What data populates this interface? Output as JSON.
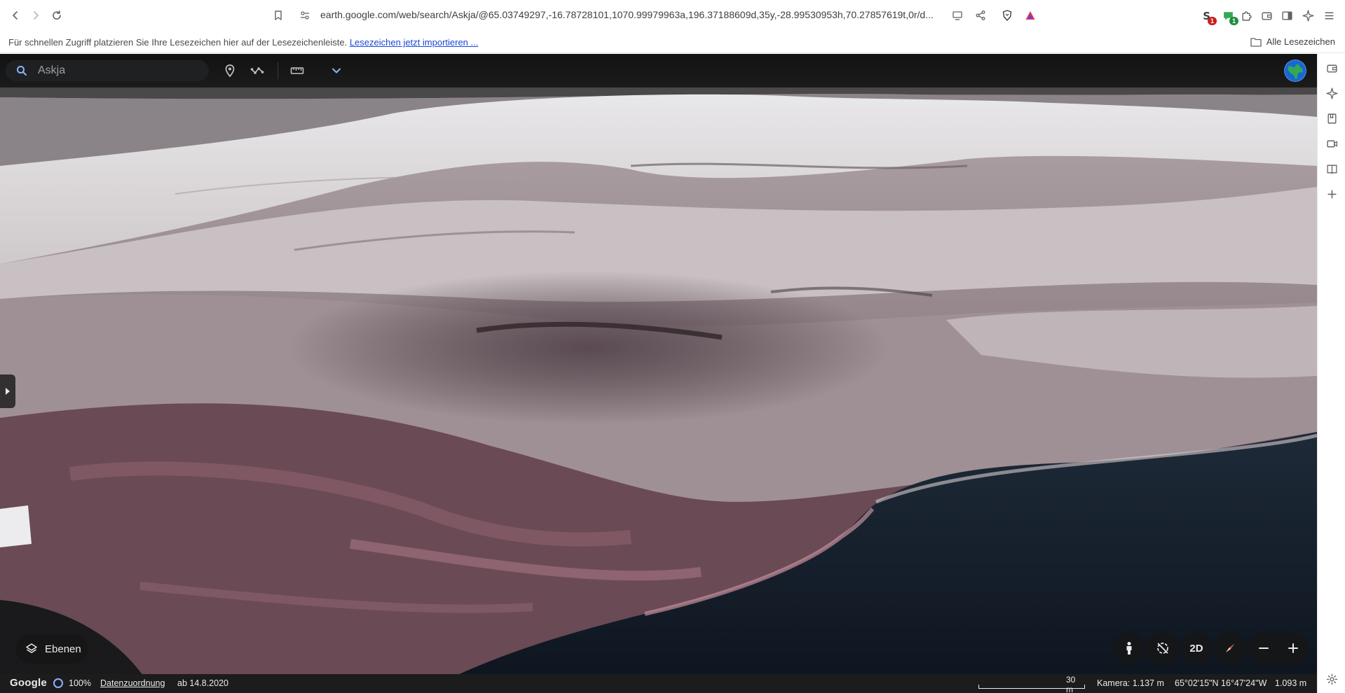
{
  "browser": {
    "url": "earth.google.com/web/search/Askja/@65.03749297,-16.78728101,1070.99979963a,196.37188609d,35y,-28.99530953h,70.27857619t,0r/d...",
    "extension_badges": [
      "1",
      "1"
    ]
  },
  "bookmarks_bar": {
    "hint_text": "Für schnellen Zugriff platzieren Sie Ihre Lesezeichen hier auf der Lesezeichenleiste.",
    "import_link": "Lesezeichen jetzt importieren ...",
    "all_bookmarks": "Alle Lesezeichen"
  },
  "earth": {
    "search": {
      "value": "",
      "placeholder": "Askja"
    },
    "layers_label": "Ebenen",
    "view_mode_label": "2D",
    "status": {
      "brand": "Google",
      "loading": "100%",
      "attribution": "Datenzuordnung",
      "imagery_date": "ab 14.8.2020",
      "scale": "30 m",
      "camera": "Kamera: 1.137 m",
      "coordinates": "65°02'15\"N 16°47'24\"W",
      "elevation": "1.093 m"
    }
  },
  "colors": {
    "accent": "#8ab4f8",
    "chrome_bg": "#ffffff",
    "earth_bar": "#1c1c1c",
    "link": "#1a47d6"
  }
}
